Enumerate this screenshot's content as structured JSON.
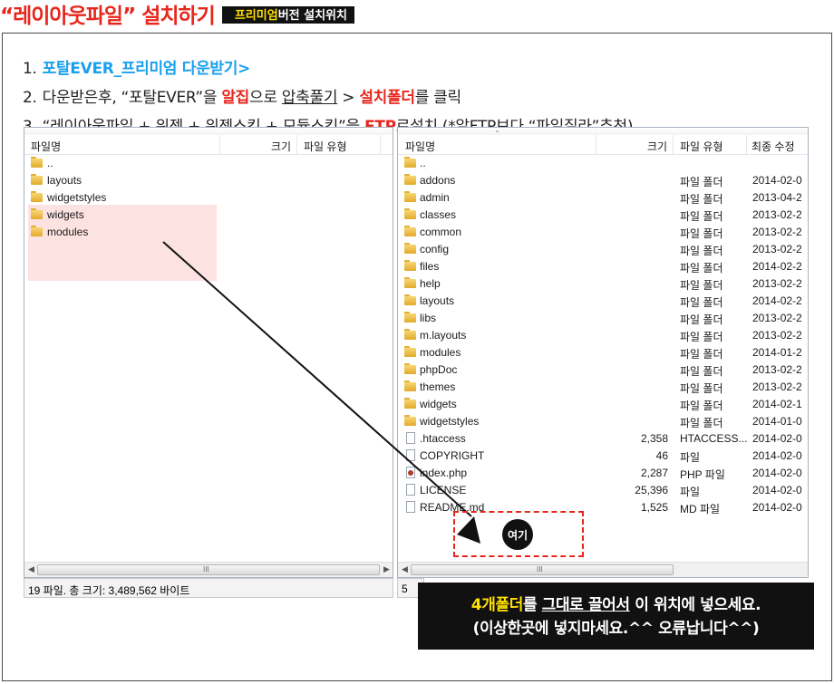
{
  "title": {
    "main": "“레이아웃파일” 설치하기",
    "badge_highlight": "프리미엄",
    "badge_rest": "버전 설치위치"
  },
  "steps": {
    "s1_num": "1.",
    "s1_link": "포탈EVER_프리미엄 다운받기>",
    "s2_num": "2.",
    "s2_a": "다운받은후, “포탈EVER”을 ",
    "s2_b": "알집",
    "s2_c": "으로 ",
    "s2_d": "압축풀기",
    "s2_e": " > ",
    "s2_f": "설치폴더",
    "s2_g": "를 클릭",
    "s3_num": "3.",
    "s3_a": "“레이아웃파일 + 위젯 + 위젯스킨 + 모듈스킨”을",
    "s3_b": " ",
    "s3_c": "FTP",
    "s3_d": "로설치 (*알FTP보다 “파일질라”추천)"
  },
  "left_pane": {
    "headers": {
      "name": "파일명",
      "size": "크기",
      "type": "파일 유형"
    },
    "items": [
      {
        "name": "..",
        "kind": "folder"
      },
      {
        "name": "layouts",
        "kind": "folder"
      },
      {
        "name": "widgetstyles",
        "kind": "folder"
      },
      {
        "name": "widgets",
        "kind": "folder"
      },
      {
        "name": "modules",
        "kind": "folder"
      }
    ],
    "status": "19 파일. 총 크기: 3,489,562 바이트",
    "scroll_grip": "III"
  },
  "right_pane": {
    "headers": {
      "name": "파일명",
      "size": "크기",
      "type": "파일 유형",
      "modified": "최종 수정"
    },
    "items": [
      {
        "name": "..",
        "kind": "folder",
        "size": "",
        "type": "",
        "date": ""
      },
      {
        "name": "addons",
        "kind": "folder",
        "size": "",
        "type": "파일 폴더",
        "date": "2014-02-0"
      },
      {
        "name": "admin",
        "kind": "folder",
        "size": "",
        "type": "파일 폴더",
        "date": "2013-04-2"
      },
      {
        "name": "classes",
        "kind": "folder",
        "size": "",
        "type": "파일 폴더",
        "date": "2013-02-2"
      },
      {
        "name": "common",
        "kind": "folder",
        "size": "",
        "type": "파일 폴더",
        "date": "2013-02-2"
      },
      {
        "name": "config",
        "kind": "folder",
        "size": "",
        "type": "파일 폴더",
        "date": "2013-02-2"
      },
      {
        "name": "files",
        "kind": "folder",
        "size": "",
        "type": "파일 폴더",
        "date": "2014-02-2"
      },
      {
        "name": "help",
        "kind": "folder",
        "size": "",
        "type": "파일 폴더",
        "date": "2013-02-2"
      },
      {
        "name": "layouts",
        "kind": "folder",
        "size": "",
        "type": "파일 폴더",
        "date": "2014-02-2"
      },
      {
        "name": "libs",
        "kind": "folder",
        "size": "",
        "type": "파일 폴더",
        "date": "2013-02-2"
      },
      {
        "name": "m.layouts",
        "kind": "folder",
        "size": "",
        "type": "파일 폴더",
        "date": "2013-02-2"
      },
      {
        "name": "modules",
        "kind": "folder",
        "size": "",
        "type": "파일 폴더",
        "date": "2014-01-2"
      },
      {
        "name": "phpDoc",
        "kind": "folder",
        "size": "",
        "type": "파일 폴더",
        "date": "2013-02-2"
      },
      {
        "name": "themes",
        "kind": "folder",
        "size": "",
        "type": "파일 폴더",
        "date": "2013-02-2"
      },
      {
        "name": "widgets",
        "kind": "folder",
        "size": "",
        "type": "파일 폴더",
        "date": "2014-02-1"
      },
      {
        "name": "widgetstyles",
        "kind": "folder",
        "size": "",
        "type": "파일 폴더",
        "date": "2014-01-0"
      },
      {
        "name": ".htaccess",
        "kind": "file",
        "size": "2,358",
        "type": "HTACCESS...",
        "date": "2014-02-0"
      },
      {
        "name": "COPYRIGHT",
        "kind": "file",
        "size": "46",
        "type": "파일",
        "date": "2014-02-0"
      },
      {
        "name": "index.php",
        "kind": "php",
        "size": "2,287",
        "type": "PHP 파일",
        "date": "2014-02-0"
      },
      {
        "name": "LICENSE",
        "kind": "file",
        "size": "25,396",
        "type": "파일",
        "date": "2014-02-0"
      },
      {
        "name": "README.md",
        "kind": "file",
        "size": "1,525",
        "type": "MD 파일",
        "date": "2014-02-0"
      }
    ],
    "status": "5",
    "scroll_grip": "III"
  },
  "here_label": "여기",
  "notice": {
    "l1_a": "4개폴더",
    "l1_b": "를 ",
    "l1_c": "그대로 끌어서",
    "l1_d": " 이 위치에 넣으세요.",
    "l2": "(이상한곳에 넣지마세요.^^ 오류납니다^^)"
  },
  "colors": {
    "accent_red": "#e8261c",
    "link_blue": "#1aa0ee",
    "highlight_yellow": "#ffe000",
    "drop_highlight": "#fde2e2"
  }
}
